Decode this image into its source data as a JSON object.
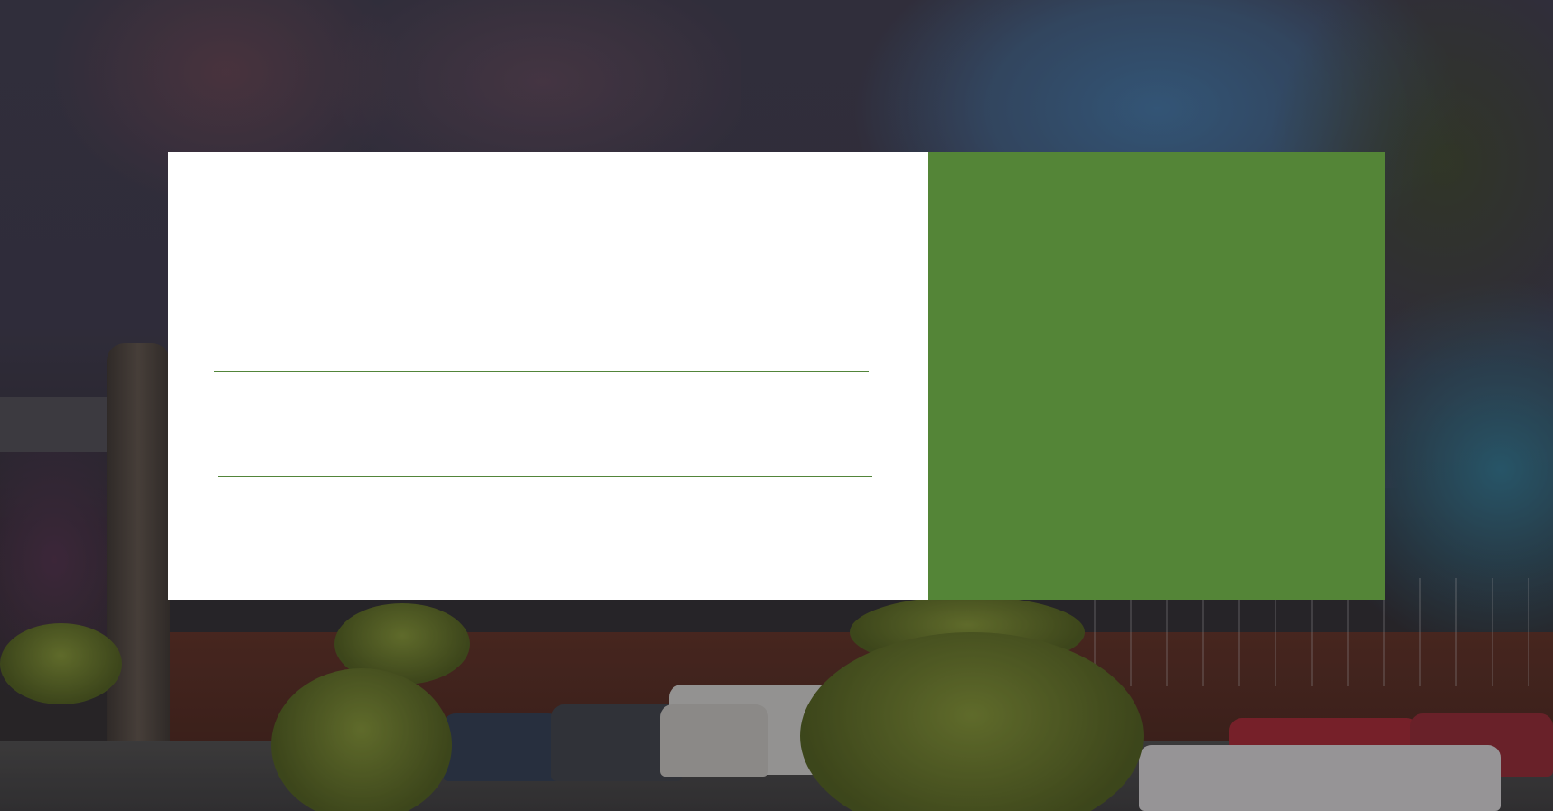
{
  "colors": {
    "accent_green": "#548537",
    "field_line": "#52853a",
    "card_background": "#ffffff"
  },
  "background": {
    "description_icon": "outdoor-photo-background"
  },
  "form_card": {
    "fields": [
      "",
      ""
    ]
  },
  "side_panel": {}
}
